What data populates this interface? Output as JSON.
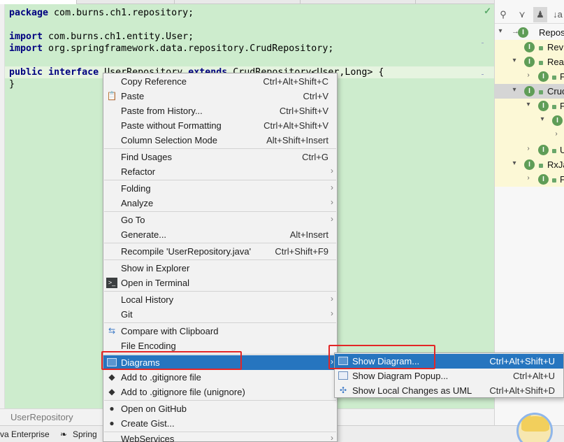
{
  "editor": {
    "filename": "UserRepository",
    "lines": {
      "package_kw": "package",
      "package_name": " com.burns.ch1.repository;",
      "import_kw_1": "import",
      "import_1": " com.burns.ch1.entity.User;",
      "import_kw_2": "import",
      "import_2": " org.springframework.data.repository.CrudRepository;",
      "public_kw": "public",
      "interface_kw": "interface",
      "class_name": "UserRepository",
      "extends_kw": "extends",
      "extends_rest": " CrudRepository<User,Long> {",
      "close_brace": "}"
    }
  },
  "context_menu": {
    "items": [
      {
        "label": "Copy Reference",
        "shortcut": "Ctrl+Alt+Shift+C"
      },
      {
        "label": "Paste",
        "shortcut": "Ctrl+V"
      },
      {
        "label": "Paste from History...",
        "shortcut": "Ctrl+Shift+V"
      },
      {
        "label": "Paste without Formatting",
        "shortcut": "Ctrl+Alt+Shift+V"
      },
      {
        "label": "Column Selection Mode",
        "shortcut": "Alt+Shift+Insert"
      },
      {
        "label": "Find Usages",
        "shortcut": "Ctrl+G"
      },
      {
        "label": "Refactor",
        "shortcut": ""
      },
      {
        "label": "Folding",
        "shortcut": ""
      },
      {
        "label": "Analyze",
        "shortcut": ""
      },
      {
        "label": "Go To",
        "shortcut": ""
      },
      {
        "label": "Generate...",
        "shortcut": "Alt+Insert"
      },
      {
        "label": "Recompile 'UserRepository.java'",
        "shortcut": "Ctrl+Shift+F9"
      },
      {
        "label": "Show in Explorer",
        "shortcut": ""
      },
      {
        "label": "Open in Terminal",
        "shortcut": ""
      },
      {
        "label": "Local History",
        "shortcut": ""
      },
      {
        "label": "Git",
        "shortcut": ""
      },
      {
        "label": "Compare with Clipboard",
        "shortcut": ""
      },
      {
        "label": "File Encoding",
        "shortcut": ""
      },
      {
        "label": "Diagrams",
        "shortcut": ""
      },
      {
        "label": "Add to .gitignore file",
        "shortcut": ""
      },
      {
        "label": "Add to .gitignore file (unignore)",
        "shortcut": ""
      },
      {
        "label": "Open on GitHub",
        "shortcut": ""
      },
      {
        "label": "Create Gist...",
        "shortcut": ""
      },
      {
        "label": "WebServices",
        "shortcut": ""
      }
    ]
  },
  "diagrams_submenu": {
    "items": [
      {
        "label": "Show Diagram...",
        "shortcut": "Ctrl+Alt+Shift+U"
      },
      {
        "label": "Show Diagram Popup...",
        "shortcut": "Ctrl+Alt+U"
      },
      {
        "label": "Show Local Changes as UML",
        "shortcut": "Ctrl+Alt+Shift+D"
      }
    ]
  },
  "structure_panel": {
    "nodes": [
      "Repos",
      "Revi",
      "Reac",
      "F",
      "Cruc",
      "F",
      "U",
      "RxJa",
      "F"
    ]
  },
  "tool_strip": {
    "items": [
      "va Enterprise",
      "Spring"
    ]
  },
  "colors": {
    "editor_bg": "#cdeccd",
    "menu_highlight": "#2675bf",
    "red_highlight": "#e32626",
    "interface_badge": "#5f9d57"
  },
  "icons": {
    "paste": "clipboard-icon",
    "terminal": "terminal-icon",
    "compare": "compare-icon",
    "diagrams": "diagram-icon",
    "gitignore": "gitignore-icon",
    "github": "github-icon"
  }
}
